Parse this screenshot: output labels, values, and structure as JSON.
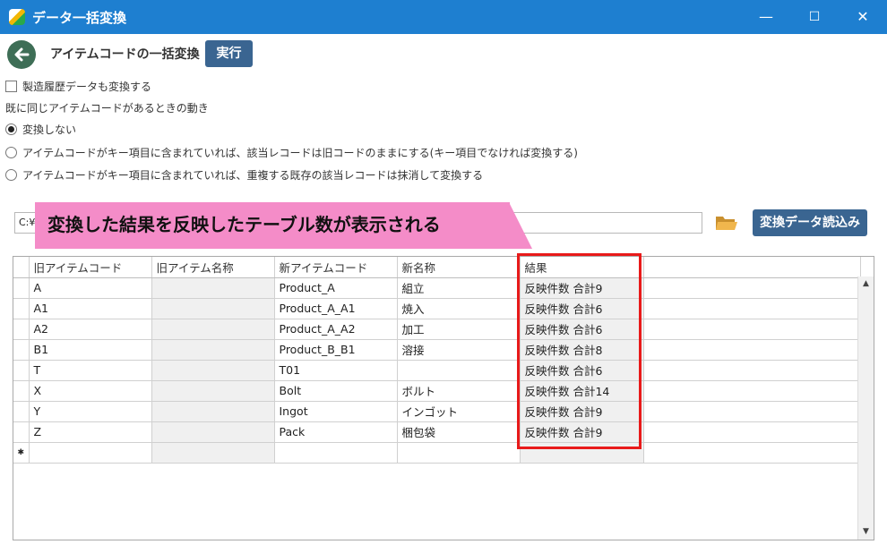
{
  "window": {
    "title": "データ一括変換",
    "minimize": "—",
    "maximize": "☐",
    "close": "✕"
  },
  "toolbar": {
    "page_title": "アイテムコードの一括変換",
    "run_label": "実行"
  },
  "options": {
    "history_checkbox": "製造履歴データも変換する",
    "section_label": "既に同じアイテムコードがあるときの動き",
    "radio": [
      {
        "label": "変換しない",
        "checked": true
      },
      {
        "label": "アイテムコードがキー項目に含まれていれば、該当レコードは旧コードのままにする(キー項目でなければ変換する)",
        "checked": false
      },
      {
        "label": "アイテムコードがキー項目に含まれていれば、重複する既存の該当レコードは抹消して変換する",
        "checked": false
      }
    ]
  },
  "file": {
    "path": "C:¥",
    "load_label": "変換データ読込み"
  },
  "callout": {
    "text": "変換した結果を反映したテーブル数が表示される"
  },
  "grid": {
    "columns": [
      "旧アイテムコード",
      "旧アイテム名称",
      "新アイテムコード",
      "新名称",
      "結果"
    ],
    "rows": [
      [
        "A",
        "",
        "Product_A",
        "組立",
        "反映件数 合計9"
      ],
      [
        "A1",
        "",
        "Product_A_A1",
        "焼入",
        "反映件数 合計6"
      ],
      [
        "A2",
        "",
        "Product_A_A2",
        "加工",
        "反映件数 合計6"
      ],
      [
        "B1",
        "",
        "Product_B_B1",
        "溶接",
        "反映件数 合計8"
      ],
      [
        "T",
        "",
        "T01",
        "",
        "反映件数 合計6"
      ],
      [
        "X",
        "",
        "Bolt",
        "ボルト",
        "反映件数 合計14"
      ],
      [
        "Y",
        "",
        "Ingot",
        "インゴット",
        "反映件数 合計9"
      ],
      [
        "Z",
        "",
        "Pack",
        "梱包袋",
        "反映件数 合計9"
      ]
    ],
    "new_row_marker": "✱"
  },
  "colors": {
    "titlebar": "#1e7fd0",
    "button": "#3a6591",
    "callout": "#f48cc8",
    "highlight": "#e81a1a"
  }
}
